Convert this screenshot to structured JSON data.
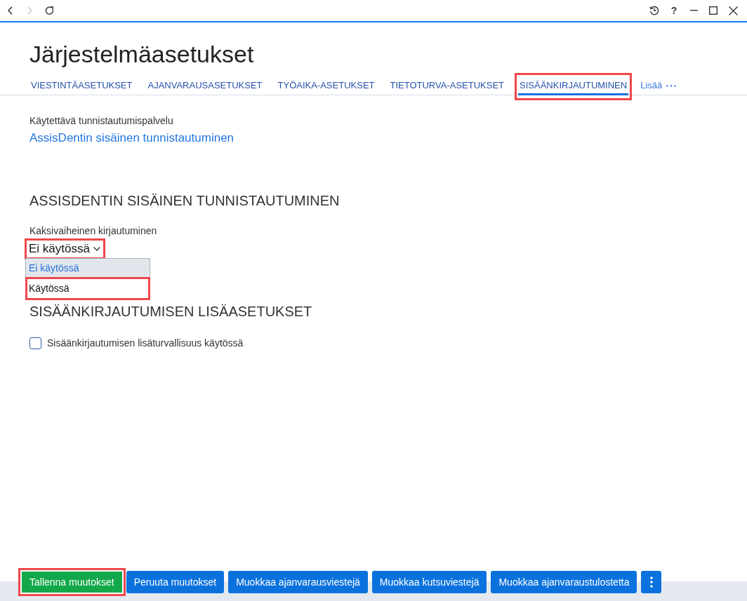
{
  "top_bar": {
    "buttons": [
      {
        "kind": "back",
        "disabled": false
      },
      {
        "kind": "forward",
        "disabled": true
      },
      {
        "kind": "reload",
        "disabled": false
      }
    ],
    "window_controls": [
      {
        "kind": "history"
      },
      {
        "kind": "help",
        "label": "?"
      },
      {
        "kind": "minimize"
      },
      {
        "kind": "maximize"
      },
      {
        "kind": "close"
      }
    ]
  },
  "page_title": "Järjestelmäasetukset",
  "tabs": [
    {
      "label": "VIESTINTÄASETUKSET",
      "selected": false,
      "highlighted": false
    },
    {
      "label": "AJANVARAUSASETUKSET",
      "selected": false,
      "highlighted": false
    },
    {
      "label": "TYÖAIKA-ASETUKSET",
      "selected": false,
      "highlighted": false
    },
    {
      "label": "TIETOTURVA-ASETUKSET",
      "selected": false,
      "highlighted": false
    },
    {
      "label": "SISÄÄNKIRJAUTUMINEN",
      "selected": true,
      "highlighted": true
    }
  ],
  "more_tabs": {
    "label": "Lisää"
  },
  "auth_service": {
    "label": "Käytettävä tunnistautumispalvelu",
    "value": "AssisDentin sisäinen tunnistautuminen"
  },
  "sections": [
    {
      "heading": "ASSISDENTIN SISÄINEN TUNNISTAUTUMINEN",
      "fields": [
        {
          "kind": "select",
          "label": "Kaksivaiheinen kirjautuminen",
          "value": "Ei käytössä",
          "expanded": true,
          "highlighted": true,
          "options": [
            {
              "label": "Ei käytössä",
              "selected": true,
              "highlighted": false
            },
            {
              "label": "Käytössä",
              "selected": false,
              "highlighted": true
            }
          ]
        }
      ]
    },
    {
      "heading": "SISÄÄNKIRJAUTUMISEN LISÄASETUKSET",
      "fields": [
        {
          "kind": "checkbox",
          "label": "Sisäänkirjautumisen lisäturvallisuus käytössä",
          "checked": false
        }
      ]
    }
  ],
  "footer": {
    "buttons": [
      {
        "kind": "save",
        "label": "Tallenna muutokset",
        "highlighted": true
      },
      {
        "kind": "cancel",
        "label": "Peruuta muutokset",
        "highlighted": false
      },
      {
        "kind": "edit",
        "label": "Muokkaa ajanvarausviestejä",
        "highlighted": false
      },
      {
        "kind": "edit",
        "label": "Muokkaa kutsuviestejä",
        "highlighted": false
      },
      {
        "kind": "edit",
        "label": "Muokkaa ajanvaraustulostetta",
        "highlighted": false
      },
      {
        "kind": "menu",
        "highlighted": false
      }
    ]
  }
}
